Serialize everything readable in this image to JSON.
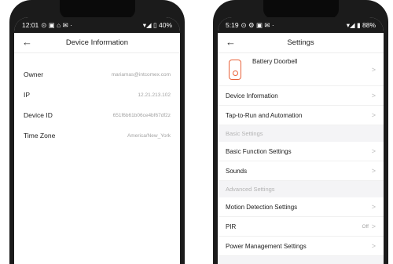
{
  "left_phone": {
    "status": {
      "time": "12:01",
      "icons": "⊙ ▣ ⌂ ✉ ·",
      "system": "▾◢ ▯ 40%"
    },
    "header": {
      "back": "←",
      "title": "Device Information"
    },
    "rows": [
      {
        "label": "Owner",
        "value": "mariamas@intcomex.com"
      },
      {
        "label": "IP",
        "value": "12.21.213.102"
      },
      {
        "label": "Device ID",
        "value": "651f6b61b06ce4bf67df2z"
      },
      {
        "label": "Time Zone",
        "value": "America/New_York"
      }
    ]
  },
  "right_phone": {
    "status": {
      "time": "5:19",
      "icons": "⊙ ⚙ ▣ ✉ ·",
      "system": "▾◢ ▮ 88%"
    },
    "header": {
      "back": "←",
      "title": "Settings"
    },
    "device": {
      "name": "Battery Doorbell",
      "icon": "doorbell-icon",
      "icon_color": "#e8623a"
    },
    "chevron": ">",
    "rows_top": [
      {
        "label": "Device Information"
      },
      {
        "label": "Tap-to-Run and Automation"
      }
    ],
    "section_basic": "Basic Settings",
    "rows_basic": [
      {
        "label": "Basic Function Settings"
      },
      {
        "label": "Sounds"
      }
    ],
    "section_advanced": "Advanced Settings",
    "rows_advanced": [
      {
        "label": "Motion Detection Settings"
      },
      {
        "label": "PIR",
        "extra": "Off"
      },
      {
        "label": "Power Management Settings"
      }
    ]
  }
}
